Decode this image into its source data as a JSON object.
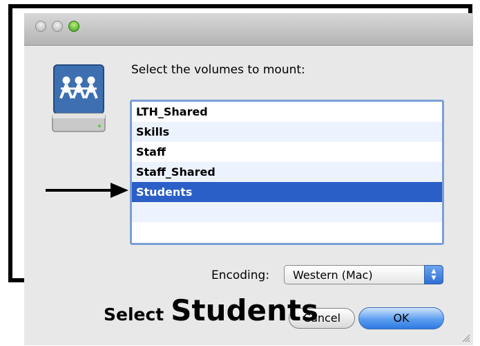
{
  "dialog": {
    "prompt": "Select the volumes to mount:",
    "volumes": [
      "LTH_Shared",
      "Skills",
      "Staff",
      "Staff_Shared",
      "Students"
    ],
    "selected_volume": "Students",
    "encoding": {
      "label": "Encoding:",
      "value": "Western (Mac)"
    },
    "buttons": {
      "cancel": "Cancel",
      "ok": "OK"
    },
    "icon": "network-drive-icon"
  },
  "annotation": {
    "caption_prefix": "Select",
    "caption_target": "Students",
    "color": "#000000"
  },
  "colors": {
    "selection": "#2a5fc7",
    "list_alt_row": "#edf3fe",
    "focus_ring": "#7a9fd4"
  }
}
